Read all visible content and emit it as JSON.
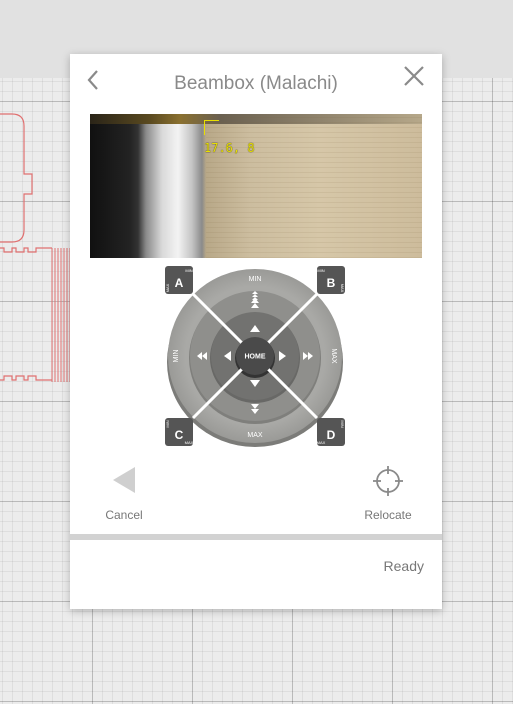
{
  "dialog": {
    "title": "Beambox (Malachi)",
    "back_icon": "chevron-left-icon",
    "close_icon": "close-icon"
  },
  "camera": {
    "coords": "17.6, 8"
  },
  "jog": {
    "home_label": "HOME",
    "min_label": "MIN",
    "max_label": "MAX",
    "corners": [
      {
        "letter": "A",
        "top": "MIN",
        "side": "MAX"
      },
      {
        "letter": "B",
        "top": "MIN",
        "side": "MAX"
      },
      {
        "letter": "C",
        "top": "MIN",
        "side": "MAX"
      },
      {
        "letter": "D",
        "top": "MIN",
        "side": "MAX"
      }
    ]
  },
  "actions": {
    "cancel_label": "Cancel",
    "relocate_label": "Relocate"
  },
  "status_text": "Ready",
  "colors": {
    "design_outline": "#e07070",
    "coords": "#e8e000",
    "jog_outer": "#a7a7a4",
    "jog_mid": "#8f8f8c",
    "jog_inner": "#707070",
    "jog_home": "#4a4a4a"
  }
}
